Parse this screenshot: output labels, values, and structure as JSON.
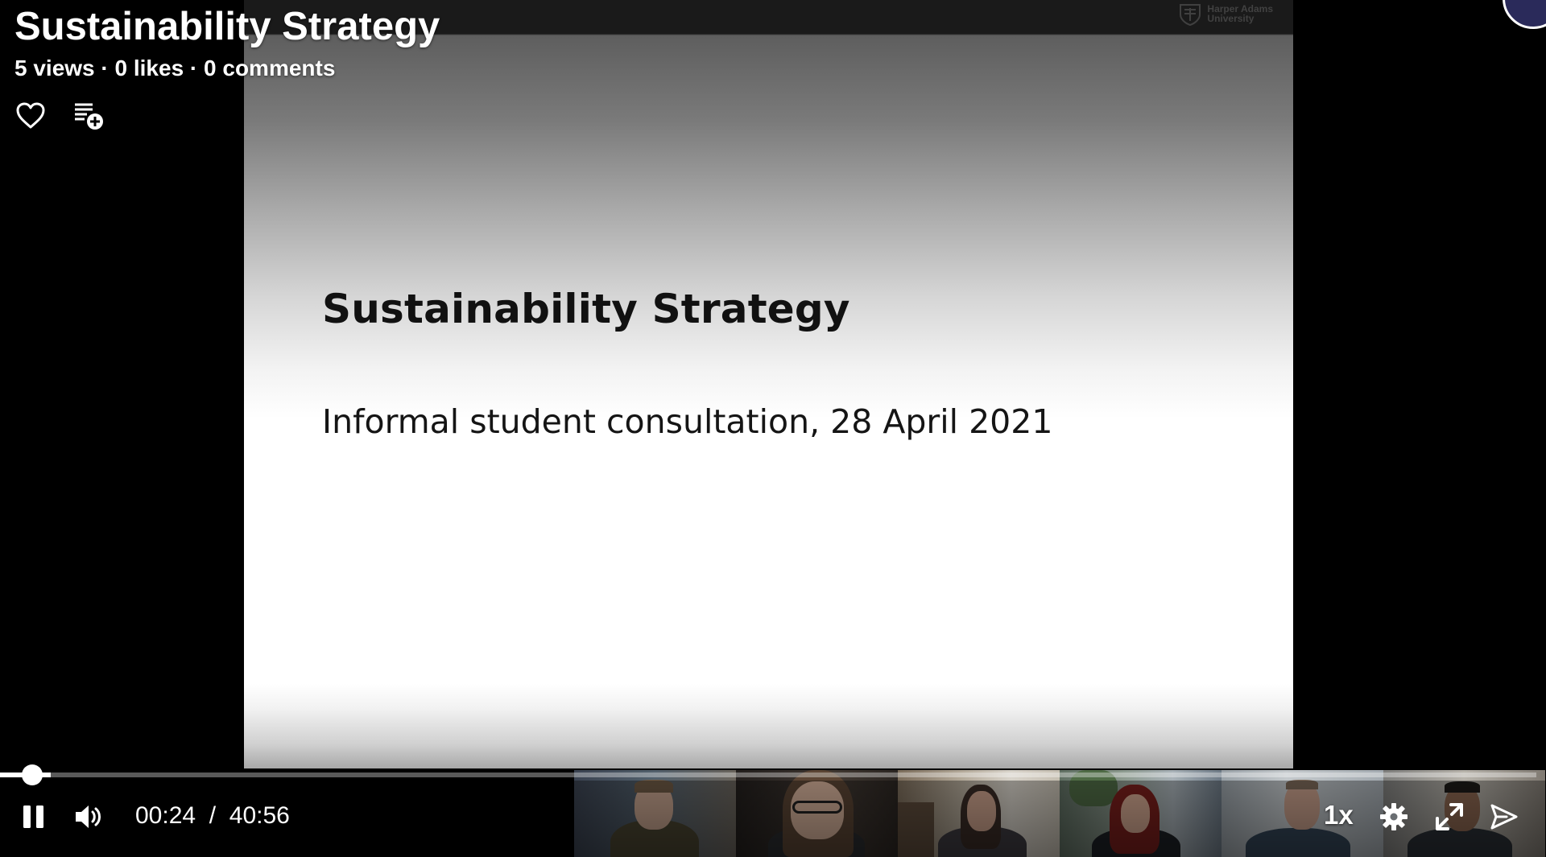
{
  "video": {
    "title": "Sustainability Strategy",
    "stats": "5 views · 0 likes · 0 comments"
  },
  "slide": {
    "logo_line1": "Harper Adams",
    "logo_line2": "University",
    "title": "Sustainability Strategy",
    "subtitle": "Informal student consultation, 28 April 2021"
  },
  "player": {
    "current_time": "00:24",
    "separator": "/",
    "duration": "40:56",
    "speed": "1x",
    "progress_fraction": 0.0098
  },
  "icons": {
    "like": "heart-icon",
    "playlist": "add-to-playlist-icon",
    "pause": "pause-icon",
    "volume": "volume-icon",
    "settings": "gear-icon",
    "fullscreen": "expand-icon",
    "share": "share-icon"
  },
  "participants": [
    {
      "name": "participant-1"
    },
    {
      "name": "participant-2"
    },
    {
      "name": "participant-3"
    },
    {
      "name": "participant-4"
    },
    {
      "name": "participant-5"
    },
    {
      "name": "participant-6"
    }
  ]
}
